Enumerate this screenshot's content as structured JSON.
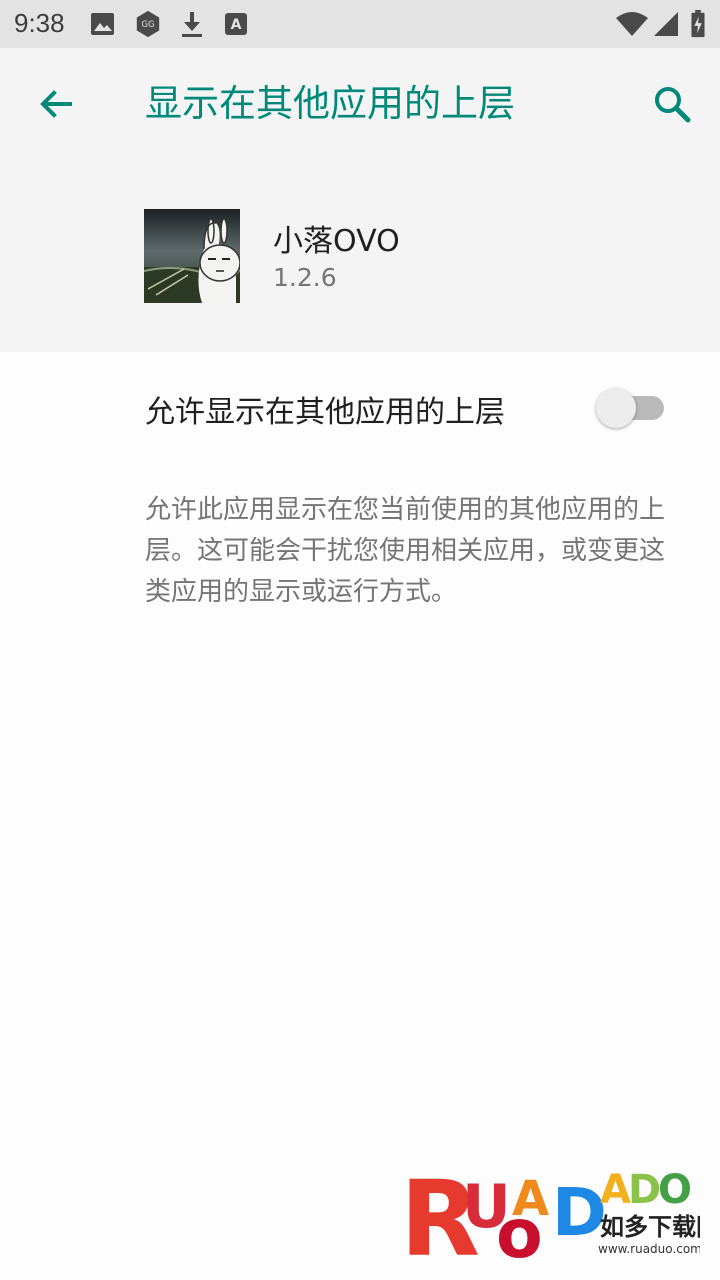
{
  "status_bar": {
    "time": "9:38",
    "left_icons": [
      "image-icon",
      "gg-shield-icon",
      "download-icon",
      "a-notification-icon"
    ],
    "right_icons": [
      "wifi-icon",
      "signal-icon",
      "battery-charging-icon"
    ]
  },
  "app_bar": {
    "title": "显示在其他应用的上层",
    "back_icon": "arrow-back-icon",
    "search_icon": "search-icon",
    "accent_color": "#00897b"
  },
  "app_info": {
    "name": "小落OVO",
    "version": "1.2.6"
  },
  "permission": {
    "label": "允许显示在其他应用的上层",
    "enabled": false
  },
  "description": "允许此应用显示在您当前使用的其他应用的上层。这可能会干扰您使用相关应用，或变更这类应用的显示或运行方式。",
  "watermark": {
    "logo_text": "RUANDADUO",
    "brand_cn": "如多下载网",
    "url": "www.ruaduo.com"
  }
}
